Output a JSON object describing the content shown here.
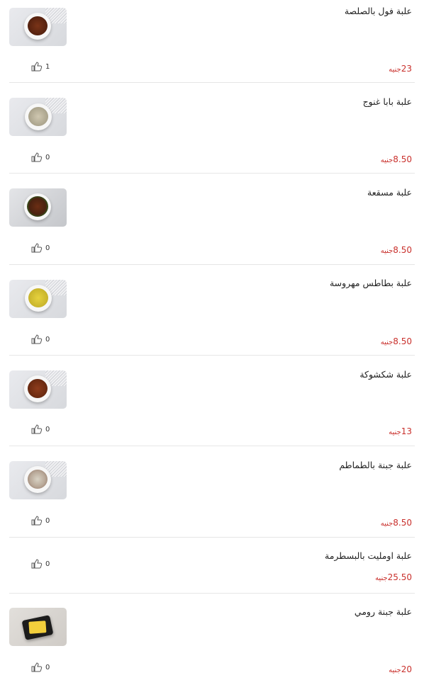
{
  "currency": "جنيه",
  "items": [
    {
      "name": "علبة فول بالصلصة",
      "price": "23",
      "likes": "1",
      "image": "brown-beans-bowl"
    },
    {
      "name": "علبة بابا غنوج",
      "price": "8.50",
      "likes": "0",
      "image": "beige-dip-bowl"
    },
    {
      "name": "علبة مسقعة",
      "price": "8.50",
      "likes": "0",
      "image": "eggplant-stew-bowl"
    },
    {
      "name": "علبة بطاطس مهروسة",
      "price": "8.50",
      "likes": "0",
      "image": "mashed-potato-bowl"
    },
    {
      "name": "علبة شكشوكة",
      "price": "13",
      "likes": "0",
      "image": "shakshuka-bowl"
    },
    {
      "name": "علبة جبنة بالطماطم",
      "price": "8.50",
      "likes": "0",
      "image": "cheese-tomato-bowl"
    },
    {
      "name": "علبة اومليت بالبسطرمة",
      "price": "25.50",
      "likes": "0",
      "image": null
    },
    {
      "name": "علبة جبنة رومي",
      "price": "20",
      "likes": "0",
      "image": "roumy-cheese-tray"
    }
  ]
}
